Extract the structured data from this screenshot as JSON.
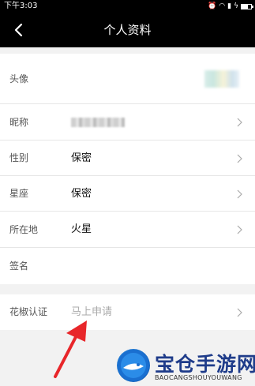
{
  "status_bar": {
    "time": "下午3:03"
  },
  "header": {
    "title": "个人资料",
    "back_icon": "chevron-left-icon"
  },
  "profile": {
    "avatar": {
      "label": "头像"
    },
    "nickname": {
      "label": "昵称"
    },
    "gender": {
      "label": "性别",
      "value": "保密"
    },
    "zodiac": {
      "label": "星座",
      "value": "保密"
    },
    "location": {
      "label": "所在地",
      "value": "火星"
    },
    "signature": {
      "label": "签名"
    }
  },
  "certification": {
    "label": "花椒认证",
    "value": "马上申请"
  },
  "annotation": {
    "arrow_color": "#e8262a"
  },
  "watermark": {
    "title": "宝仓手游网",
    "subtitle": "BAOCANGSHOUYOUWANG"
  },
  "colors": {
    "nav_bg": "#000000",
    "page_bg": "#f2f2f2",
    "row_bg": "#ffffff",
    "divider": "#e6e6e6"
  }
}
